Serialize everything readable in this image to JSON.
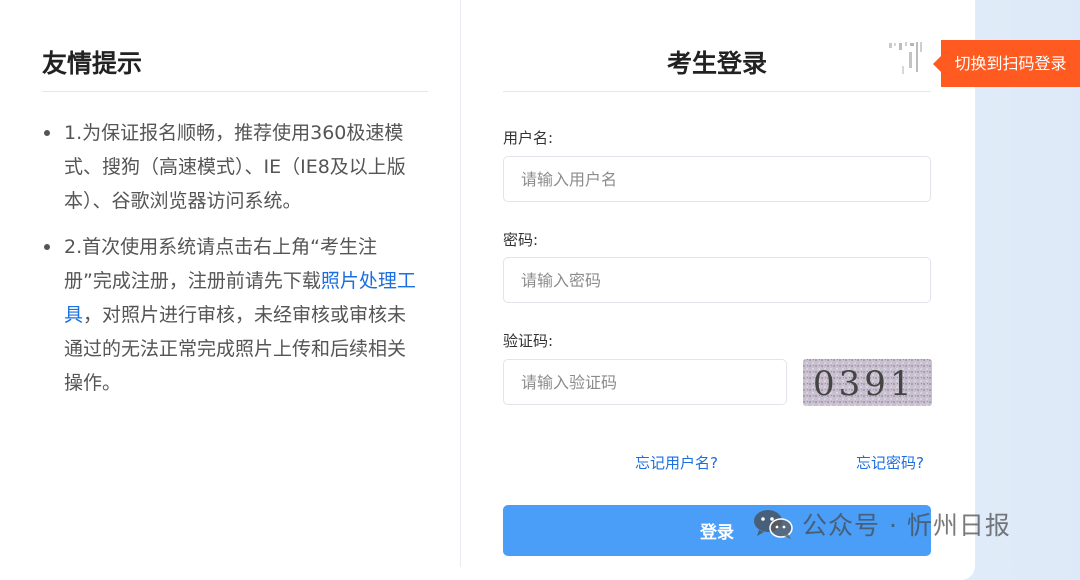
{
  "tips": {
    "title": "友情提示",
    "item1": "1.为保证报名顺畅，推荐使用360极速模式、搜狗（高速模式）、IE（IE8及以上版本）、谷歌浏览器访问系统。",
    "item2_before": "2.首次使用系统请点击右上角“考生注册”完成注册，注册前请先下载",
    "item2_link": "照片处理工具",
    "item2_after": "，对照片进行审核，未经审核或审核未通过的无法正常完成照片上传和后续相关操作。"
  },
  "login": {
    "title": "考生登录",
    "qr_switch": "切换到扫码登录",
    "username_label": "用户名:",
    "username_placeholder": "请输入用户名",
    "password_label": "密码:",
    "password_placeholder": "请输入密码",
    "captcha_label": "验证码:",
    "captcha_placeholder": "请输入验证码",
    "captcha_code": "0391",
    "forgot_username": "忘记用户名?",
    "forgot_password": "忘记密码?",
    "submit": "登录"
  },
  "watermark": {
    "text": "公众号 · 忻州日报",
    "icon": "wechat-icon"
  },
  "colors": {
    "accent": "#4a9ef7",
    "link": "#1b6fe0",
    "qr_badge": "#ff5a1f"
  }
}
